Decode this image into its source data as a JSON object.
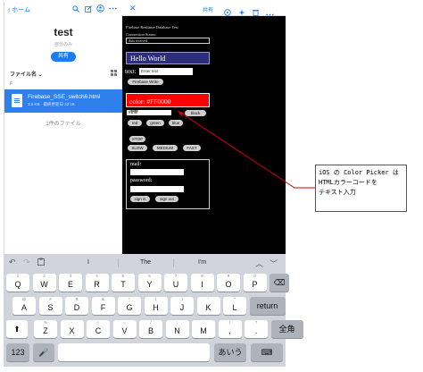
{
  "files_pane": {
    "back_label": "ホーム",
    "folder_title": "test",
    "folder_subtitle": "自分のみ",
    "share_label": "共有",
    "sort_label": "ファイル名 ⌄",
    "section_letter": "F",
    "file": {
      "name": "Firebase_SSE_switch6.html",
      "meta": "3.6 KB · 最終更新日 22:16"
    },
    "file_count": "1件のファイル"
  },
  "browser_pane": {
    "share_label": "共有",
    "page": {
      "title": "Firebase Realtime Database Test",
      "connection_label": "Connection Status:",
      "connection_value": "data received",
      "hello_text": "Hello World",
      "text_label": "text:",
      "text_input_value": "Enter text",
      "firebase_write_label": "Firebase Write",
      "color_text": "color: #FF0000",
      "color_input_value": "#ffffff",
      "black_label": "black",
      "color_buttons": [
        "red",
        "green",
        "blue"
      ],
      "stop_label": "STOP",
      "speed_buttons": [
        "SLOW",
        "MEDIUM",
        "FAST"
      ],
      "mail_label": "mail:",
      "password_label": "password:",
      "signin_label": "sign in",
      "signout_label": "sign out"
    }
  },
  "annotation": {
    "lines": [
      "iOS の Color Picker は",
      "HTMLカラーコードを",
      "テキスト入力"
    ],
    "color": "#cc0000"
  },
  "keyboard": {
    "suggestions": [
      "I",
      "The",
      "I'm"
    ],
    "row1": [
      [
        "1",
        "Q"
      ],
      [
        "2",
        "W"
      ],
      [
        "3",
        "E"
      ],
      [
        "4",
        "R"
      ],
      [
        "5",
        "T"
      ],
      [
        "6",
        "Y"
      ],
      [
        "7",
        "U"
      ],
      [
        "8",
        "I"
      ],
      [
        "9",
        "O"
      ],
      [
        "0",
        "P"
      ]
    ],
    "row2": [
      [
        "@",
        "A"
      ],
      [
        "#",
        "S"
      ],
      [
        "$",
        "D"
      ],
      [
        "&",
        "F"
      ],
      [
        "*",
        "G"
      ],
      [
        "(",
        "H"
      ],
      [
        ")",
        "J"
      ],
      [
        "'",
        "K"
      ],
      [
        "\"",
        "L"
      ]
    ],
    "row3": [
      [
        "%",
        "Z"
      ],
      [
        "-",
        "X"
      ],
      [
        "+",
        "C"
      ],
      [
        "=",
        "V"
      ],
      [
        "/",
        "B"
      ],
      [
        ";",
        "N"
      ],
      [
        ":",
        "M"
      ],
      [
        "!",
        ","
      ],
      [
        "?",
        "."
      ]
    ],
    "return_label": "return",
    "zenkaku_label": "全角",
    "numbers_label": "123",
    "aiu_label": "あいう"
  }
}
